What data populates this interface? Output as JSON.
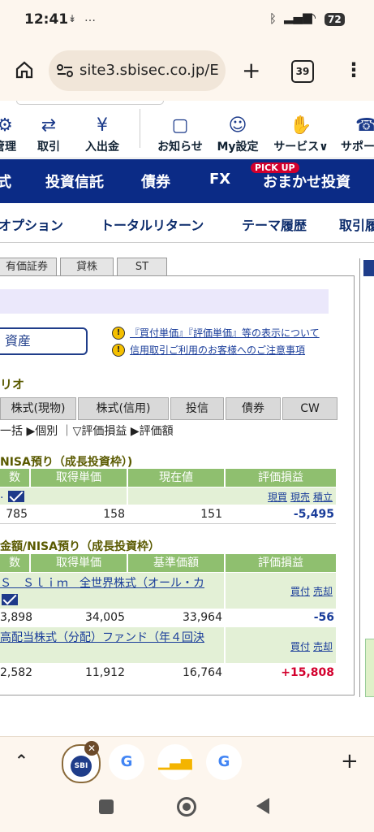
{
  "status": {
    "time": "12:41",
    "indicators": "…",
    "battery": "72"
  },
  "browser": {
    "url": "site3.sbisec.co.jp/E",
    "tab_count": "39",
    "plus": "+",
    "menu": "⋮"
  },
  "header_icons": [
    {
      "label": "管理",
      "icon": "gear-icon"
    },
    {
      "label": "取引",
      "icon": "exchange-icon"
    },
    {
      "label": "入出金",
      "icon": "yen-icon"
    },
    {
      "label": "お知らせ",
      "icon": "chat-icon"
    },
    {
      "label": "My設定",
      "icon": "user-gear-icon"
    },
    {
      "label": "サービス∨",
      "icon": "hand-icon"
    },
    {
      "label": "サポー",
      "icon": "headset-icon"
    }
  ],
  "main_nav": [
    {
      "label": "式"
    },
    {
      "label": "投資信託"
    },
    {
      "label": "債券"
    },
    {
      "label": "FX"
    },
    {
      "label": "おまかせ投資",
      "badge": "PICK UP"
    }
  ],
  "sub_nav": [
    "オプション",
    "トータルリターン",
    "テーマ履歴",
    "取引履"
  ],
  "content_tabs": [
    "有価証券",
    "貸株",
    "ST"
  ],
  "asset_button": "資産",
  "notices": [
    "『買付単価』『評価単価』等の表示について",
    "信用取引ご利用のお客様へのご注意事項"
  ],
  "portfolio_title": "リオ",
  "portfolio_tabs": [
    "株式(現物)",
    "株式(信用)",
    "投信",
    "債券",
    "CW"
  ],
  "filters": "一括 ▶個別 ｜▽評価損益 ▶評価額",
  "stock_section": {
    "title": "NISA預り（成長投資枠）)",
    "headers": [
      "数",
      "取得単価",
      "現在値",
      "評価損益"
    ],
    "actions": [
      "現買",
      "現売",
      "積立"
    ],
    "row": {
      "qty": "785",
      "cost": "158",
      "price": "151",
      "pl": "-5,495"
    }
  },
  "fund_section": {
    "title": "金額/NISA預り（成長投資枠）",
    "headers": [
      "数",
      "取得単価",
      "基準価額",
      "評価損益"
    ],
    "funds": [
      {
        "name": "Ｓ　Ｓｌｉｍ　全世界株式（オール・カ",
        "buy": "買付",
        "sell": "売却",
        "qty": "3,898",
        "cost": "34,005",
        "price": "33,964",
        "pl": "-56"
      },
      {
        "name": "高配当株式（分配）ファンド（年４回決",
        "buy": "買付",
        "sell": "売却",
        "qty": "2,582",
        "cost": "11,912",
        "price": "16,764",
        "pl": "+15,808"
      }
    ]
  },
  "bottom_tabs": {
    "active": "SBI",
    "others": [
      "G",
      "chart",
      "G"
    ]
  }
}
